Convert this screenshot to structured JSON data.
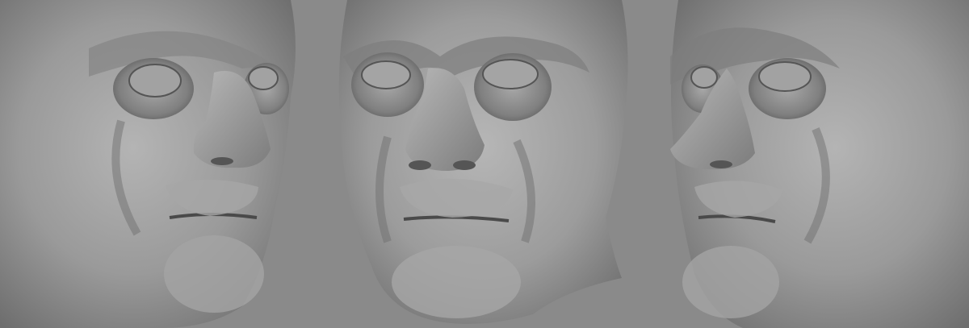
{
  "scene": {
    "background_color": "#8a8a8a",
    "surface_color": "#9c9c9c",
    "views": [
      {
        "name": "three-quarter-right",
        "icon": "sculpt-head-render"
      },
      {
        "name": "front",
        "icon": "sculpt-head-render"
      },
      {
        "name": "three-quarter-left",
        "icon": "sculpt-head-render"
      }
    ]
  }
}
